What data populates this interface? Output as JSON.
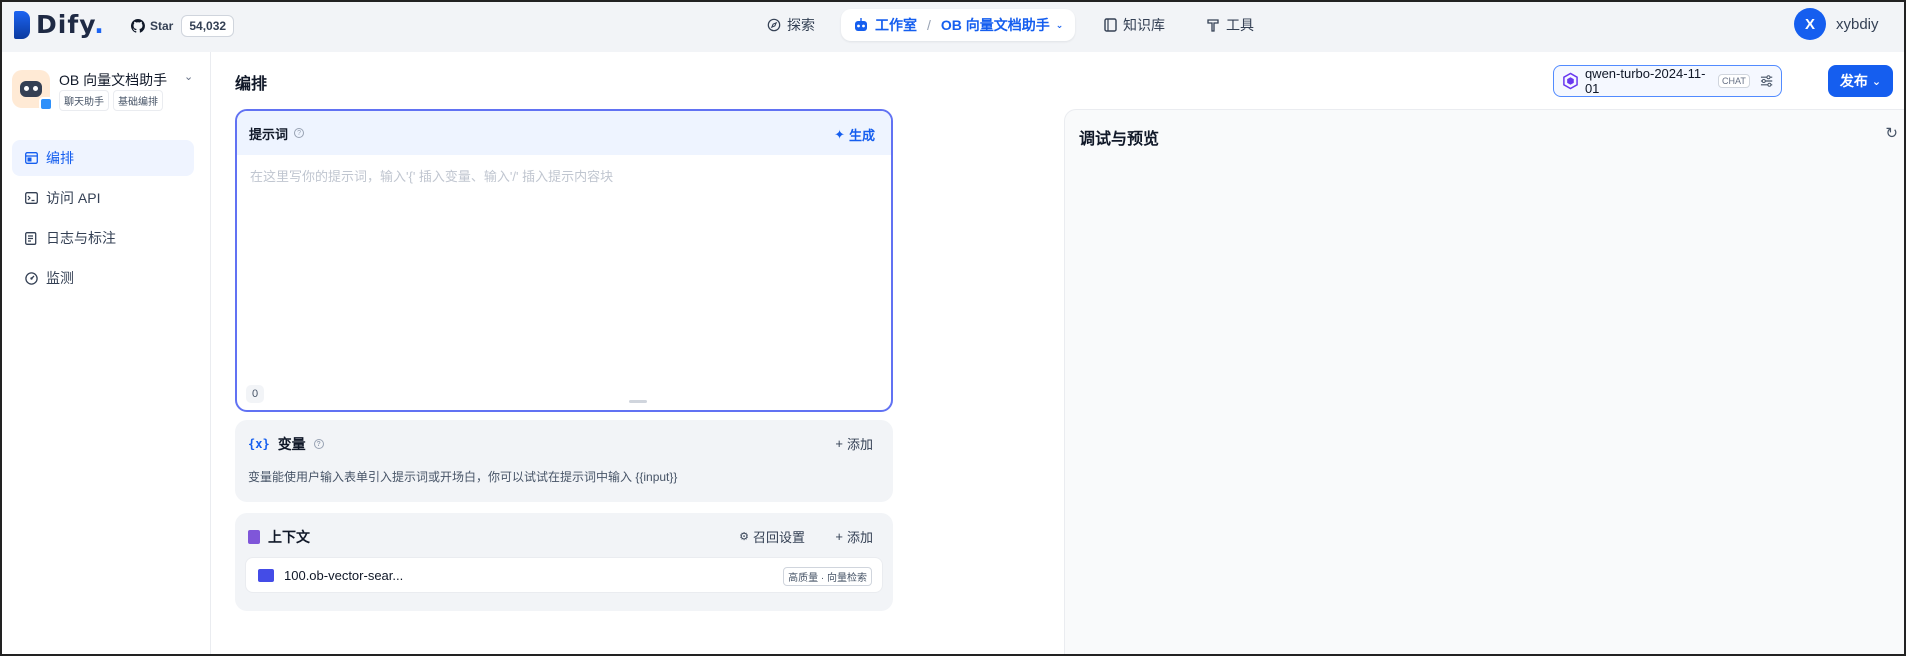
{
  "brand": {
    "name": "Dify",
    "accent": "#155eef"
  },
  "github": {
    "star_label": "Star",
    "count": "54,032"
  },
  "nav": {
    "explore": "探索",
    "studio": "工作室",
    "separator": "/",
    "current_app": "OB 向量文档助手",
    "knowledge": "知识库",
    "tools": "工具"
  },
  "user": {
    "initial": "X",
    "name": "xybdiy"
  },
  "app": {
    "name": "OB 向量文档助手",
    "tags": [
      "聊天助手",
      "基础编排"
    ]
  },
  "sidebar": {
    "items": [
      {
        "label": "编排",
        "icon": "layout-icon",
        "active": true
      },
      {
        "label": "访问 API",
        "icon": "terminal-icon",
        "active": false
      },
      {
        "label": "日志与标注",
        "icon": "log-icon",
        "active": false
      },
      {
        "label": "监测",
        "icon": "monitor-icon",
        "active": false
      }
    ]
  },
  "main": {
    "title": "编排",
    "model": {
      "name": "qwen-turbo-2024-11-01",
      "mode": "CHAT"
    },
    "publish": "发布"
  },
  "prompt": {
    "title": "提示词",
    "generate": "生成",
    "placeholder": "在这里写你的提示词，输入'{' 插入变量、输入'/' 插入提示内容块",
    "count": "0"
  },
  "variables": {
    "title": "变量",
    "icon_text": "{x}",
    "add": "添加",
    "description": "变量能使用户输入表单引入提示词或开场白，你可以试试在提示词中输入 {{input}}"
  },
  "context": {
    "title": "上下文",
    "recall": "召回设置",
    "add": "添加",
    "dataset": {
      "name": "100.ob-vector-sear...",
      "tag": "高质量 · 向量检索"
    }
  },
  "debug": {
    "title": "调试与预览"
  }
}
